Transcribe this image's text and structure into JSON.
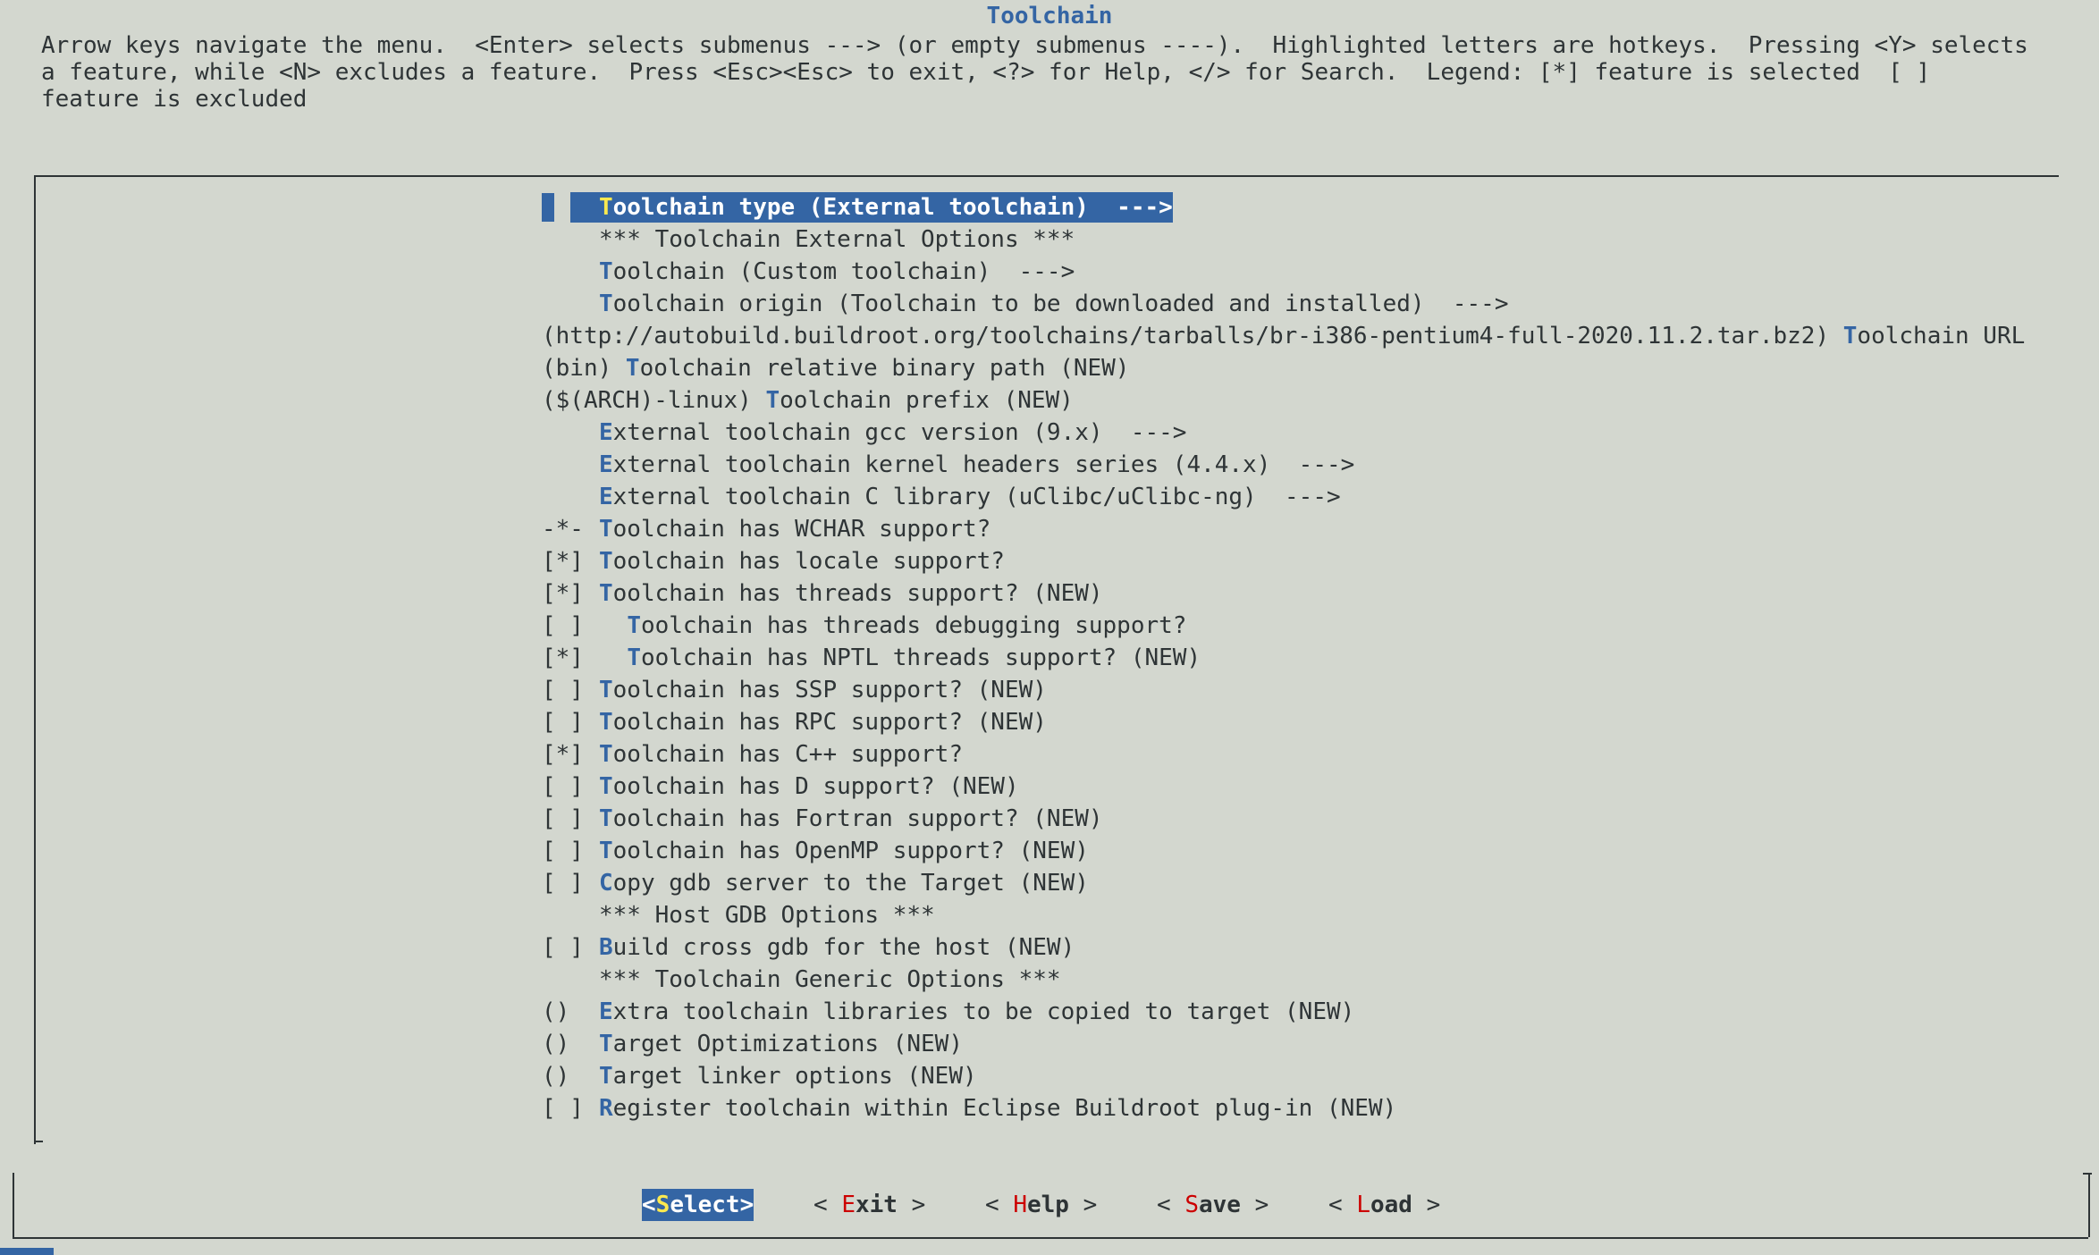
{
  "window": {
    "title": "Toolchain"
  },
  "help": {
    "text": "Arrow keys navigate the menu.  <Enter> selects submenus ---> (or empty submenus ----).  Highlighted letters are hotkeys.  Pressing <Y> selects\na feature, while <N> excludes a feature.  Press <Esc><Esc> to exit, <?> for Help, </> for Search.  Legend: [*] feature is selected  [ ]\nfeature is excluded"
  },
  "menu": {
    "items": [
      {
        "prefix": "",
        "indent": "",
        "hot": "T",
        "rest": "oolchain type (External toolchain)  --->",
        "selected": true
      },
      {
        "prefix": "",
        "indent": "",
        "hot": "",
        "rest": "*** Toolchain External Options ***"
      },
      {
        "prefix": "",
        "indent": "",
        "hot": "T",
        "rest": "oolchain (Custom toolchain)  --->"
      },
      {
        "prefix": "",
        "indent": "",
        "hot": "T",
        "rest": "oolchain origin (Toolchain to be downloaded and installed)  --->"
      },
      {
        "prefix": "(http://autobuild.buildroot.org/toolchains/tarballs/br-i386-pentium4-full-2020.11.2.tar.bz2) ",
        "indent": "",
        "hot": "T",
        "rest": "oolchain URL",
        "raw": true
      },
      {
        "prefix": "(bin) ",
        "indent": "",
        "hot": "T",
        "rest": "oolchain relative binary path (NEW)",
        "raw": true
      },
      {
        "prefix": "($(ARCH)-linux) ",
        "indent": "",
        "hot": "T",
        "rest": "oolchain prefix (NEW)",
        "raw": true
      },
      {
        "prefix": "",
        "indent": "",
        "hot": "E",
        "rest": "xternal toolchain gcc version (9.x)  --->"
      },
      {
        "prefix": "",
        "indent": "",
        "hot": "E",
        "rest": "xternal toolchain kernel headers series (4.4.x)  --->"
      },
      {
        "prefix": "",
        "indent": "",
        "hot": "E",
        "rest": "xternal toolchain C library (uClibc/uClibc-ng)  --->"
      },
      {
        "prefix": "-*-",
        "indent": "",
        "hot": "T",
        "rest": "oolchain has WCHAR support?"
      },
      {
        "prefix": "[*]",
        "indent": "",
        "hot": "T",
        "rest": "oolchain has locale support?"
      },
      {
        "prefix": "[*]",
        "indent": "",
        "hot": "T",
        "rest": "oolchain has threads support? (NEW)"
      },
      {
        "prefix": "[ ]",
        "indent": "  ",
        "hot": "T",
        "rest": "oolchain has threads debugging support?"
      },
      {
        "prefix": "[*]",
        "indent": "  ",
        "hot": "T",
        "rest": "oolchain has NPTL threads support? (NEW)"
      },
      {
        "prefix": "[ ]",
        "indent": "",
        "hot": "T",
        "rest": "oolchain has SSP support? (NEW)"
      },
      {
        "prefix": "[ ]",
        "indent": "",
        "hot": "T",
        "rest": "oolchain has RPC support? (NEW)"
      },
      {
        "prefix": "[*]",
        "indent": "",
        "hot": "T",
        "rest": "oolchain has C++ support?"
      },
      {
        "prefix": "[ ]",
        "indent": "",
        "hot": "T",
        "rest": "oolchain has D support? (NEW)"
      },
      {
        "prefix": "[ ]",
        "indent": "",
        "hot": "T",
        "rest": "oolchain has Fortran support? (NEW)"
      },
      {
        "prefix": "[ ]",
        "indent": "",
        "hot": "T",
        "rest": "oolchain has OpenMP support? (NEW)"
      },
      {
        "prefix": "[ ]",
        "indent": "",
        "hot": "C",
        "rest": "opy gdb server to the Target (NEW)"
      },
      {
        "prefix": "",
        "indent": "",
        "hot": "",
        "rest": "*** Host GDB Options ***"
      },
      {
        "prefix": "[ ]",
        "indent": "",
        "hot": "B",
        "rest": "uild cross gdb for the host (NEW)"
      },
      {
        "prefix": "",
        "indent": "",
        "hot": "",
        "rest": "*** Toolchain Generic Options ***"
      },
      {
        "prefix": "()",
        "indent": "",
        "hot": "E",
        "rest": "xtra toolchain libraries to be copied to target (NEW)"
      },
      {
        "prefix": "()",
        "indent": "",
        "hot": "T",
        "rest": "arget Optimizations (NEW)"
      },
      {
        "prefix": "()",
        "indent": "",
        "hot": "T",
        "rest": "arget linker options (NEW)"
      },
      {
        "prefix": "[ ]",
        "indent": "",
        "hot": "R",
        "rest": "egister toolchain within Eclipse Buildroot plug-in (NEW)"
      }
    ]
  },
  "buttons": [
    {
      "open": "<",
      "key": "S",
      "rest": "elect",
      "close": ">",
      "selected": true
    },
    {
      "open": "< ",
      "key": "E",
      "rest": "xit",
      "close": " >"
    },
    {
      "open": "< ",
      "key": "H",
      "rest": "elp",
      "close": " >"
    },
    {
      "open": "< ",
      "key": "S",
      "rest": "ave",
      "close": " >"
    },
    {
      "open": "< ",
      "key": "L",
      "rest": "oad",
      "close": " >"
    }
  ],
  "colors": {
    "background": "#d3d7cf",
    "accent": "#3465a4",
    "hotkey_selected": "#fce94f",
    "button_key": "#cc0000"
  }
}
